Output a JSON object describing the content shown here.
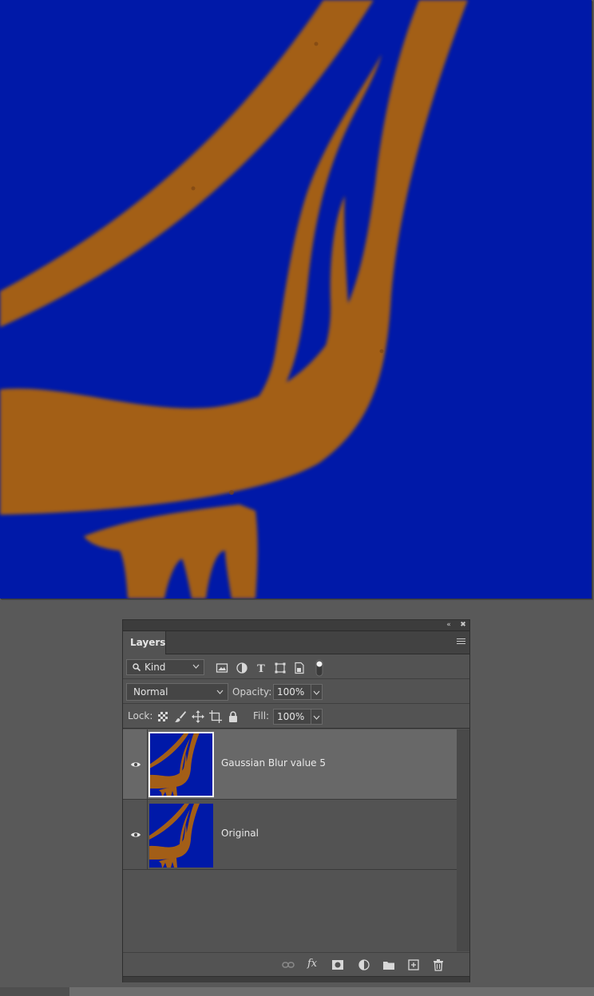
{
  "colors": {
    "canvas_background": "#0019a8",
    "shape_fill": "#a35e17",
    "panel_background": "#535353",
    "selected_row": "#686868"
  },
  "panel": {
    "collapse_icon": "double-chevron-left-icon",
    "close_icon": "close-icon",
    "tab_label": "Layers",
    "menu_icon": "hamburger-menu-icon"
  },
  "filter": {
    "kind_label": "Kind",
    "icons": [
      "image-filter-icon",
      "adjustment-filter-icon",
      "type-filter-icon",
      "shape-filter-icon",
      "smart-object-filter-icon",
      "filter-toggle-icon"
    ]
  },
  "blend": {
    "mode": "Normal",
    "opacity_label": "Opacity:",
    "opacity_value": "100%"
  },
  "lock": {
    "label": "Lock:",
    "icons": [
      "lock-transparent-icon",
      "lock-image-icon",
      "lock-position-icon",
      "lock-artboard-icon",
      "lock-all-icon"
    ],
    "fill_label": "Fill:",
    "fill_value": "100%"
  },
  "layers": [
    {
      "name": "Gaussian Blur value 5",
      "visible": true,
      "selected": true
    },
    {
      "name": "Original",
      "visible": true,
      "selected": false
    }
  ],
  "bottom_bar": {
    "icons": [
      "link-layers-icon",
      "fx-icon",
      "add-mask-icon",
      "adjustment-layer-icon",
      "new-group-icon",
      "new-layer-icon",
      "delete-layer-icon"
    ],
    "fx_label": "fx"
  }
}
